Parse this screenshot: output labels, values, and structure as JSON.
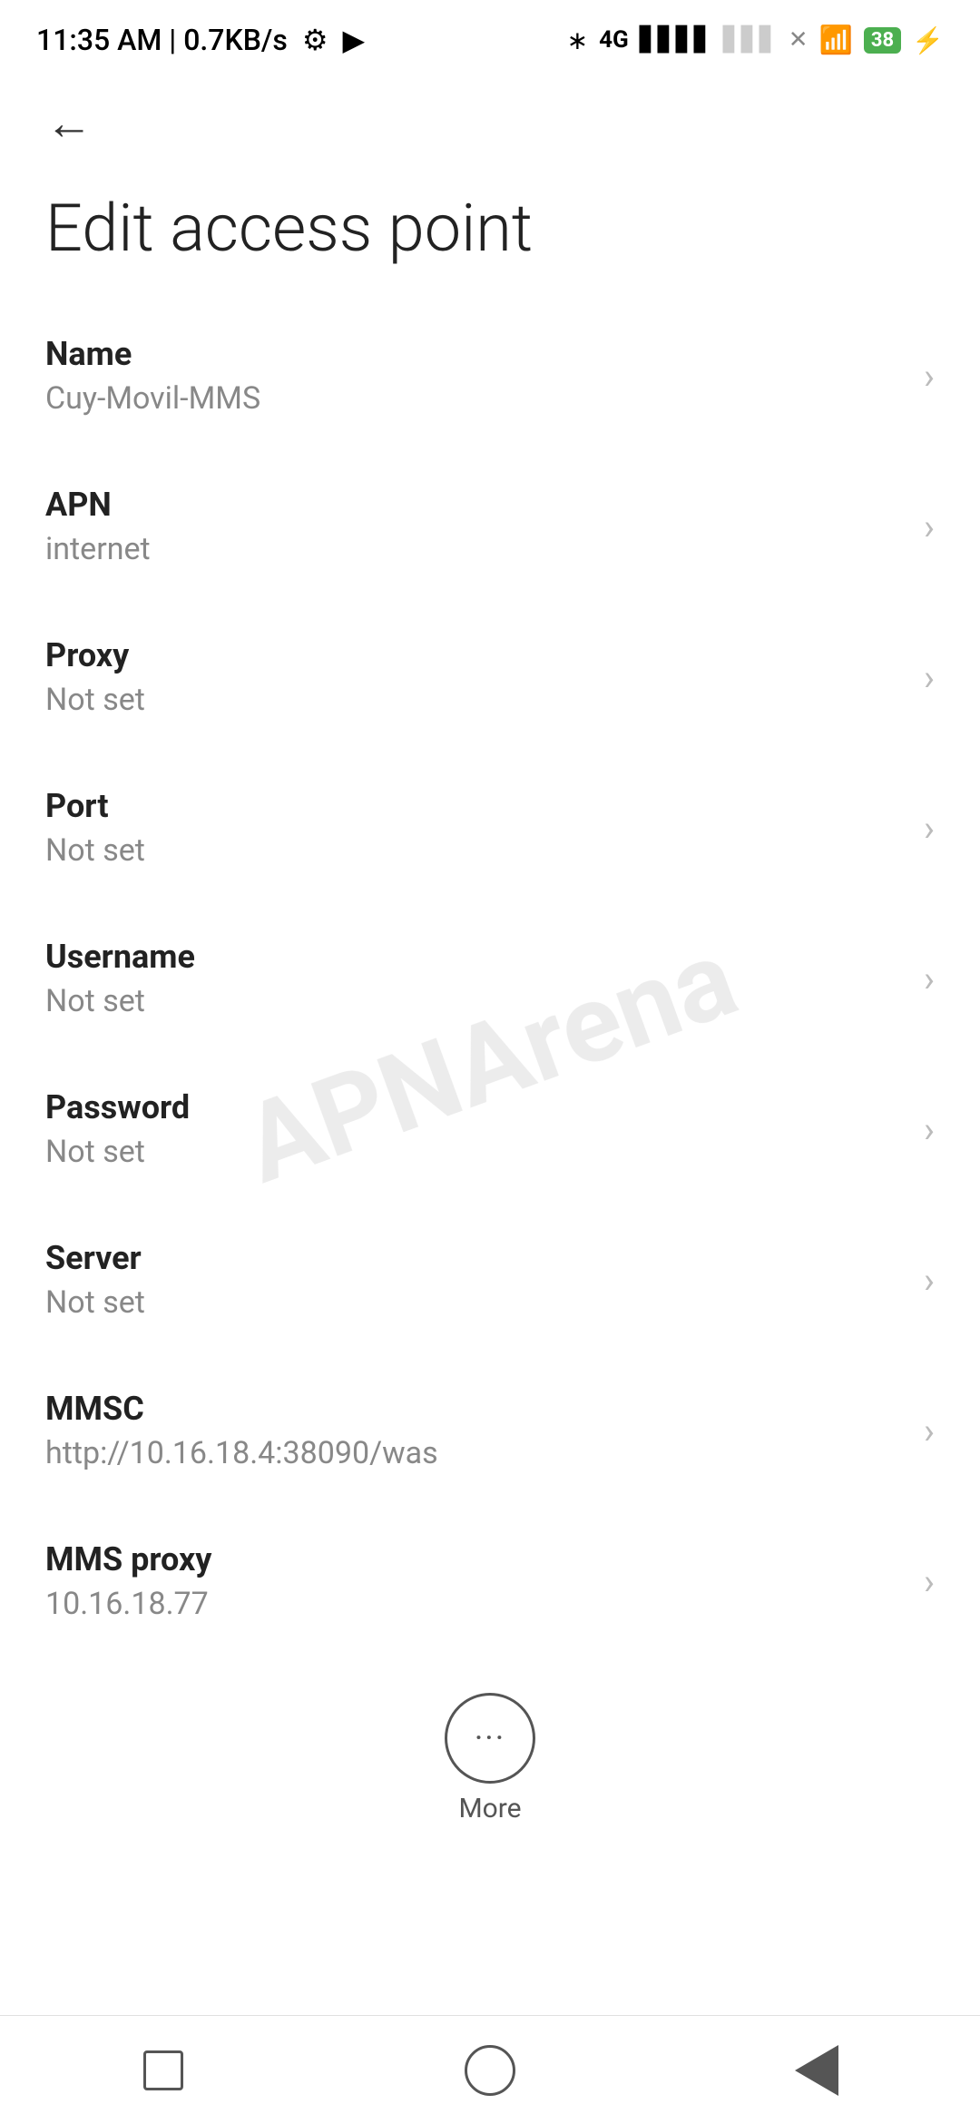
{
  "statusBar": {
    "time": "11:35 AM | 0.7KB/s",
    "battery": "38"
  },
  "nav": {
    "backLabel": "←"
  },
  "page": {
    "title": "Edit access point"
  },
  "settings": [
    {
      "label": "Name",
      "value": "Cuy-Movil-MMS"
    },
    {
      "label": "APN",
      "value": "internet"
    },
    {
      "label": "Proxy",
      "value": "Not set"
    },
    {
      "label": "Port",
      "value": "Not set"
    },
    {
      "label": "Username",
      "value": "Not set"
    },
    {
      "label": "Password",
      "value": "Not set"
    },
    {
      "label": "Server",
      "value": "Not set"
    },
    {
      "label": "MMSC",
      "value": "http://10.16.18.4:38090/was"
    },
    {
      "label": "MMS proxy",
      "value": "10.16.18.77"
    }
  ],
  "more": {
    "label": "More"
  }
}
